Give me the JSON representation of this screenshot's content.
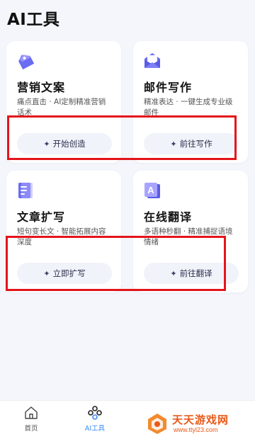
{
  "page": {
    "title": "AI工具"
  },
  "cards": [
    {
      "title": "营销文案",
      "desc": "痛点直击 · AI定制精准营销话术",
      "button": "开始创造",
      "icon": "tag-icon",
      "icon_color": "#6a6cf2"
    },
    {
      "title": "邮件写作",
      "desc": "精准表达 · 一键生成专业级邮件",
      "button": "前往写作",
      "icon": "mail-icon",
      "icon_color": "#6a6cf2"
    },
    {
      "title": "文章扩写",
      "desc": "短句变长文 · 智能拓展内容深度",
      "button": "立即扩写",
      "icon": "document-icon",
      "icon_color": "#6a6cf2"
    },
    {
      "title": "在线翻译",
      "desc": "多语种秒翻 · 精准捕捉语境情绪",
      "button": "前往翻译",
      "icon": "translate-icon",
      "icon_color": "#6a6cf2"
    }
  ],
  "tabbar": {
    "home": "首页",
    "tools": "AI工具",
    "active_color": "#3a8df0"
  },
  "watermark": {
    "name": "天天游戏网",
    "url": "www.ttyl23.com"
  },
  "colors": {
    "highlight": "#e4141b",
    "accent": "#6a6cf2"
  }
}
